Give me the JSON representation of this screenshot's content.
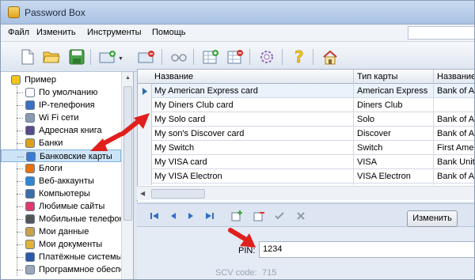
{
  "window": {
    "title": "Password Box"
  },
  "menu": {
    "items": [
      "Файл",
      "Изменить",
      "Инструменты",
      "Помощь"
    ]
  },
  "toolbar": {
    "buttons": [
      "new-document-icon",
      "open-folder-icon",
      "save-disk-icon",
      "add-item-icon",
      "delete-item-icon",
      "glasses-icon",
      "add-record-icon",
      "delete-record-icon",
      "gear-icon",
      "help-icon",
      "home-icon"
    ]
  },
  "tree": {
    "items": [
      {
        "label": "Пример",
        "icon": "lightbulb-icon"
      },
      {
        "label": "По умолчанию",
        "icon": "blank-document-icon"
      },
      {
        "label": "IP-телефония",
        "icon": "phone-icon"
      },
      {
        "label": "Wi Fi сети",
        "icon": "wifi-icon"
      },
      {
        "label": "Адресная книга",
        "icon": "book-icon"
      },
      {
        "label": "Банки",
        "icon": "coin-icon"
      },
      {
        "label": "Банковские карты",
        "icon": "card-icon"
      },
      {
        "label": "Блоги",
        "icon": "blogger-icon"
      },
      {
        "label": "Веб-аккаунты",
        "icon": "globe-icon"
      },
      {
        "label": "Компьютеры",
        "icon": "computer-icon"
      },
      {
        "label": "Любимые сайты",
        "icon": "heart-icon"
      },
      {
        "label": "Мобильные телефоны",
        "icon": "mobile-icon"
      },
      {
        "label": "Мои данные",
        "icon": "user-icon"
      },
      {
        "label": "Мои документы",
        "icon": "folder-icon"
      },
      {
        "label": "Платёжные системы",
        "icon": "paypal-icon"
      },
      {
        "label": "Программное обеспечение",
        "icon": "software-icon"
      }
    ]
  },
  "grid": {
    "columns": [
      "Название",
      "Тип карты",
      "Название"
    ],
    "rows": [
      [
        "My American Express  card",
        "American Express",
        "Bank of Am"
      ],
      [
        "My Diners Club  card",
        "Diners Club",
        ""
      ],
      [
        "My Solo card",
        "Solo",
        "Bank of Am"
      ],
      [
        "My son's Discover card",
        "Discover",
        "Bank of Am"
      ],
      [
        "My Switch",
        "Switch",
        "First Ameri"
      ],
      [
        "My VISA card",
        "VISA",
        "Bank Unite"
      ],
      [
        "My VISA Electron",
        "VISA Electron",
        "Bank of Am"
      ]
    ]
  },
  "detail": {
    "edit_label": "Изменить",
    "pin_label": "PIN:",
    "pin_value": "1234",
    "cvv_label": "SCV code:",
    "cvv_value": "715"
  },
  "colors": {
    "accent": "#3a7bd5",
    "arrow": "#e0201c",
    "selection": "#cde4f7"
  }
}
